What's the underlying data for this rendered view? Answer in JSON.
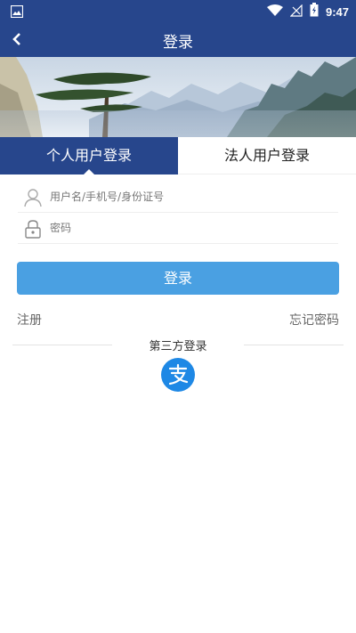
{
  "status_bar": {
    "time": "9:47",
    "icons": [
      "image-icon",
      "wifi-icon",
      "signal-icon",
      "battery-icon"
    ]
  },
  "header": {
    "title": "登录",
    "back_icon": "chevron-left-icon",
    "bg_color": "#27468c"
  },
  "banner": {
    "description_icon": "landscape-image"
  },
  "tabs": [
    {
      "label": "个人用户登录",
      "active": true
    },
    {
      "label": "法人用户登录",
      "active": false
    }
  ],
  "form": {
    "username_placeholder": "用户名/手机号/身份证号",
    "username_value": "",
    "password_placeholder": "密码",
    "password_value": "",
    "login_label": "登录",
    "login_color": "#4aa0e2"
  },
  "links": {
    "register": "注册",
    "forgot_password": "忘记密码"
  },
  "third_party": {
    "label": "第三方登录",
    "providers": [
      {
        "icon": "alipay-icon",
        "color": "#1e88e5"
      }
    ]
  }
}
